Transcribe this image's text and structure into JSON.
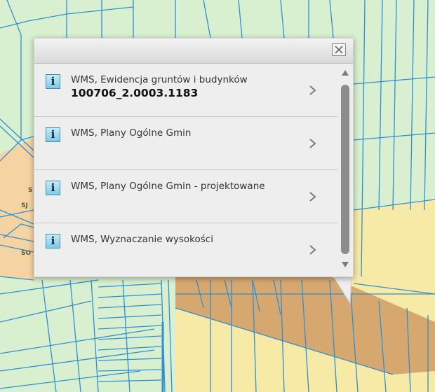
{
  "map": {
    "labels": [
      "S",
      "SJ",
      "SO"
    ],
    "colors": {
      "background": "#d8f0cf",
      "parcel_line": "#2f8fd0",
      "yellow_zone": "#f7e9a6",
      "tan_zone": "#d9b27c",
      "peach_zone": "#f6d3a3",
      "brown_strip": "#d6a870"
    }
  },
  "popup": {
    "close_icon": "close-icon",
    "items": [
      {
        "icon": "info-icon",
        "icon_text": "i",
        "title": "WMS, Ewidencja gruntów i budynków",
        "value": "100706_2.0003.1183"
      },
      {
        "icon": "info-icon",
        "icon_text": "i",
        "title": "WMS, Plany Ogólne Gmin",
        "value": ""
      },
      {
        "icon": "info-icon",
        "icon_text": "i",
        "title": "WMS, Plany Ogólne Gmin - projektowane",
        "value": ""
      },
      {
        "icon": "info-icon",
        "icon_text": "i",
        "title": "WMS, Wyznaczanie wysokości",
        "value": ""
      }
    ]
  }
}
